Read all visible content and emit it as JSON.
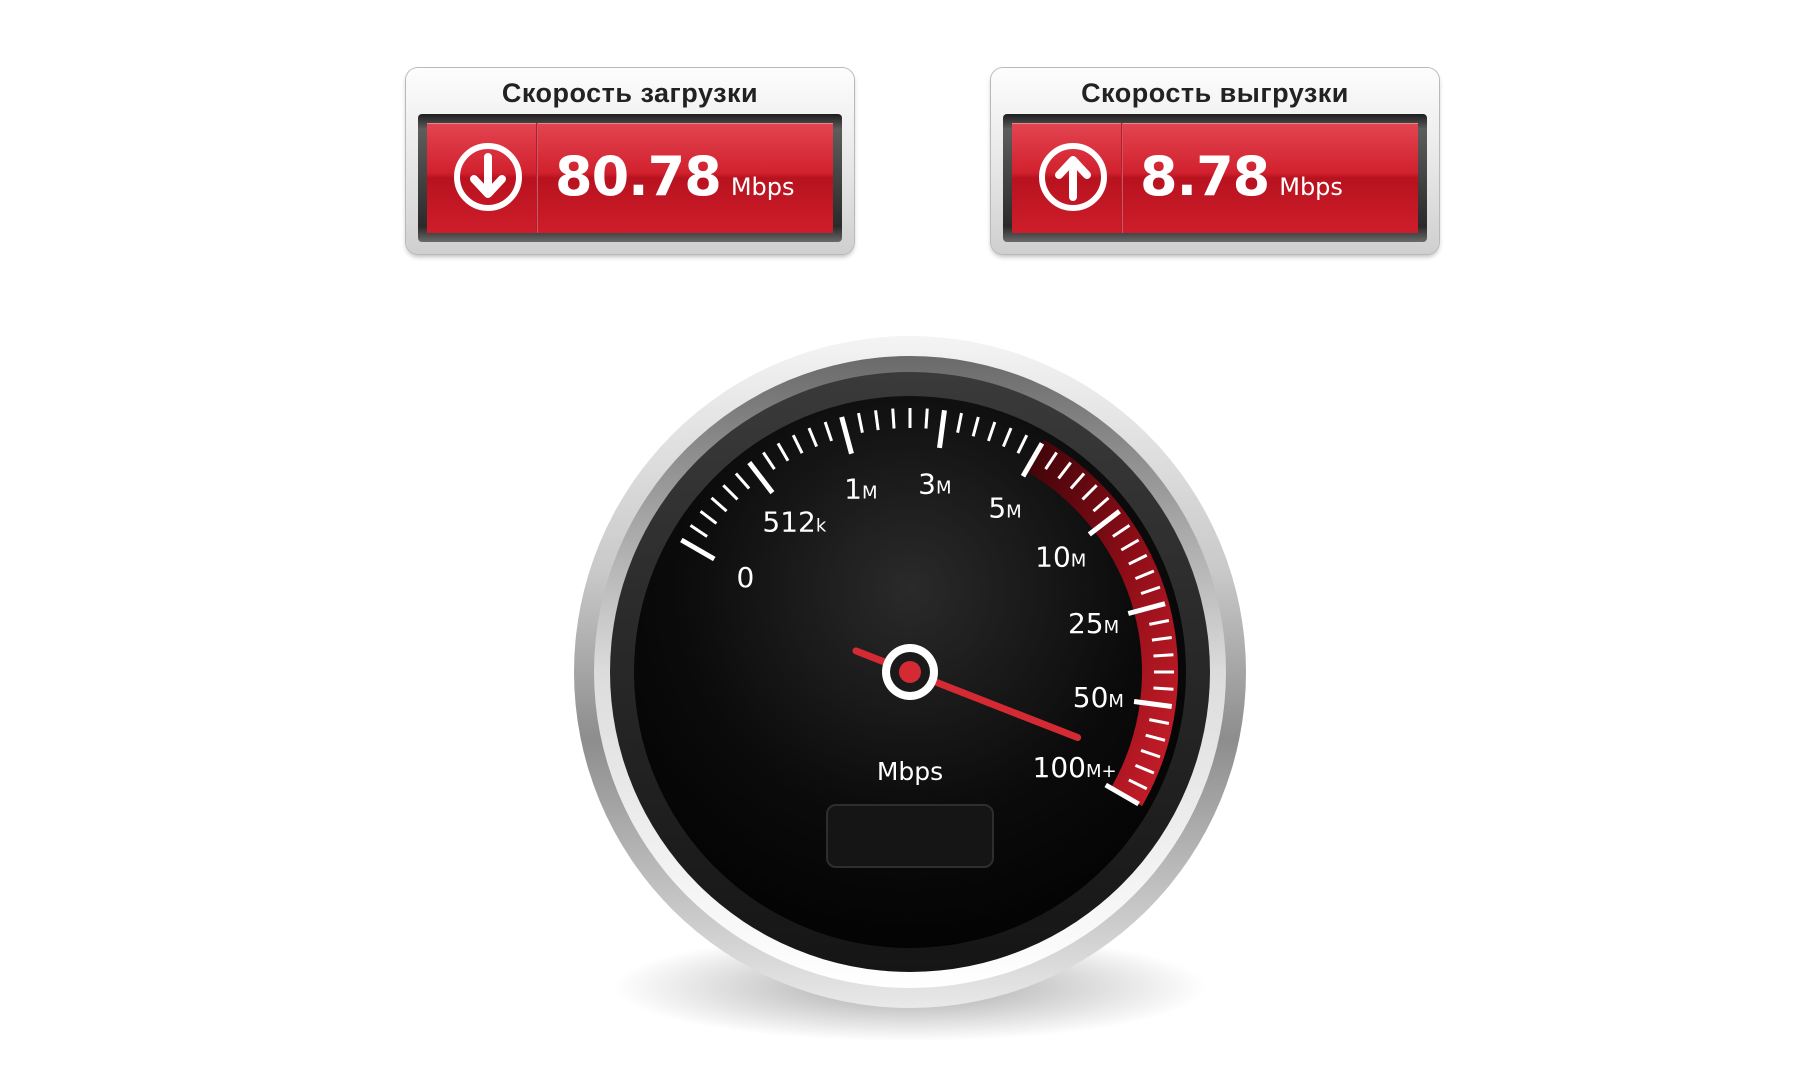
{
  "download": {
    "title": "Скорость загрузки",
    "value": "80.78",
    "unit": "Mbps",
    "icon": "arrow-down-circle-icon"
  },
  "upload": {
    "title": "Скорость выгрузки",
    "value": "8.78",
    "unit": "Mbps",
    "icon": "arrow-up-circle-icon"
  },
  "gauge": {
    "unit_label": "Mbps",
    "scale": [
      {
        "main": "0",
        "suffix": ""
      },
      {
        "main": "512",
        "suffix": "k"
      },
      {
        "main": "1",
        "suffix": "M"
      },
      {
        "main": "3",
        "suffix": "M"
      },
      {
        "main": "5",
        "suffix": "M"
      },
      {
        "main": "10",
        "suffix": "M"
      },
      {
        "main": "25",
        "suffix": "M"
      },
      {
        "main": "50",
        "suffix": "M"
      },
      {
        "main": "100",
        "suffix": "M+"
      }
    ],
    "readout": "",
    "needle_reading_mbps": 80.78
  },
  "colors": {
    "accent_red": "#d2212e",
    "dial_black": "#0c0c0c",
    "tick_white": "#ffffff"
  }
}
